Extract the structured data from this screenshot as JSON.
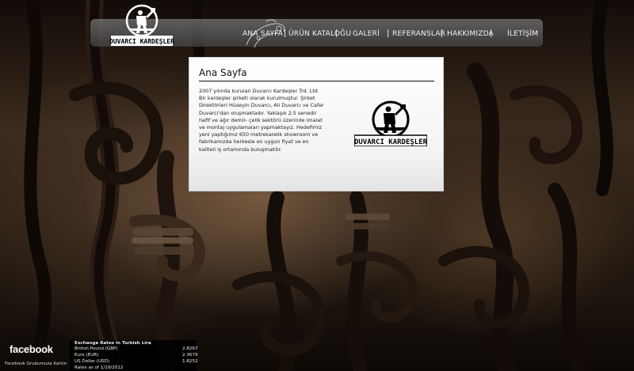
{
  "brand": {
    "name": "DUVARCI KARDEŞLER"
  },
  "nav": {
    "items": [
      {
        "label": "ANA SAYFA"
      },
      {
        "label": "ÜRÜN KATALOĞU"
      },
      {
        "label": "GALERİ"
      },
      {
        "label": "REFERANSLAR"
      },
      {
        "label": "HAKKIMIZDA"
      },
      {
        "label": "İLETİŞİM"
      }
    ]
  },
  "content": {
    "title": "Ana Sayfa",
    "body": "2007 yılında kurulan Duvarcı Kardeşler Trd. Ltd. Bir kardeşler şirketi olarak kurulmuştur. Şirket Direktörleri Hüseyin Duvarcı, Ali Duvarcı ve Cafer Duvarci'dan oluşmaktadır. Yaklaşık 2,5 senedir hafif ve ağır demir- çelik sektörü üzerinde imalat ve montaj uygulamaları yapmaktayız. Hedefimiz yeni yaptığımız 650 metrekarelik showroom ve fabrikamızda herkesle en uygun fiyat ve en kaliteli iş ortamında buluşmaktır."
  },
  "footer": {
    "facebook": {
      "label": "facebook",
      "subtext": "Facebook Grubumuza Katılın"
    },
    "rates": {
      "title": "Exchange Rates in Turkish Lira",
      "rows": [
        {
          "currency": "British Pound (GBP)",
          "value": "2.8267"
        },
        {
          "currency": "Euro (EUR)",
          "value": "2.3679"
        },
        {
          "currency": "US Dollar (USD)",
          "value": "1.8252"
        }
      ],
      "date": "Rates as of 1/19/2012"
    }
  },
  "colors": {
    "nav_bg": "#6e6e6e",
    "panel_bg": "#ffffff",
    "text_dark": "#111111"
  }
}
